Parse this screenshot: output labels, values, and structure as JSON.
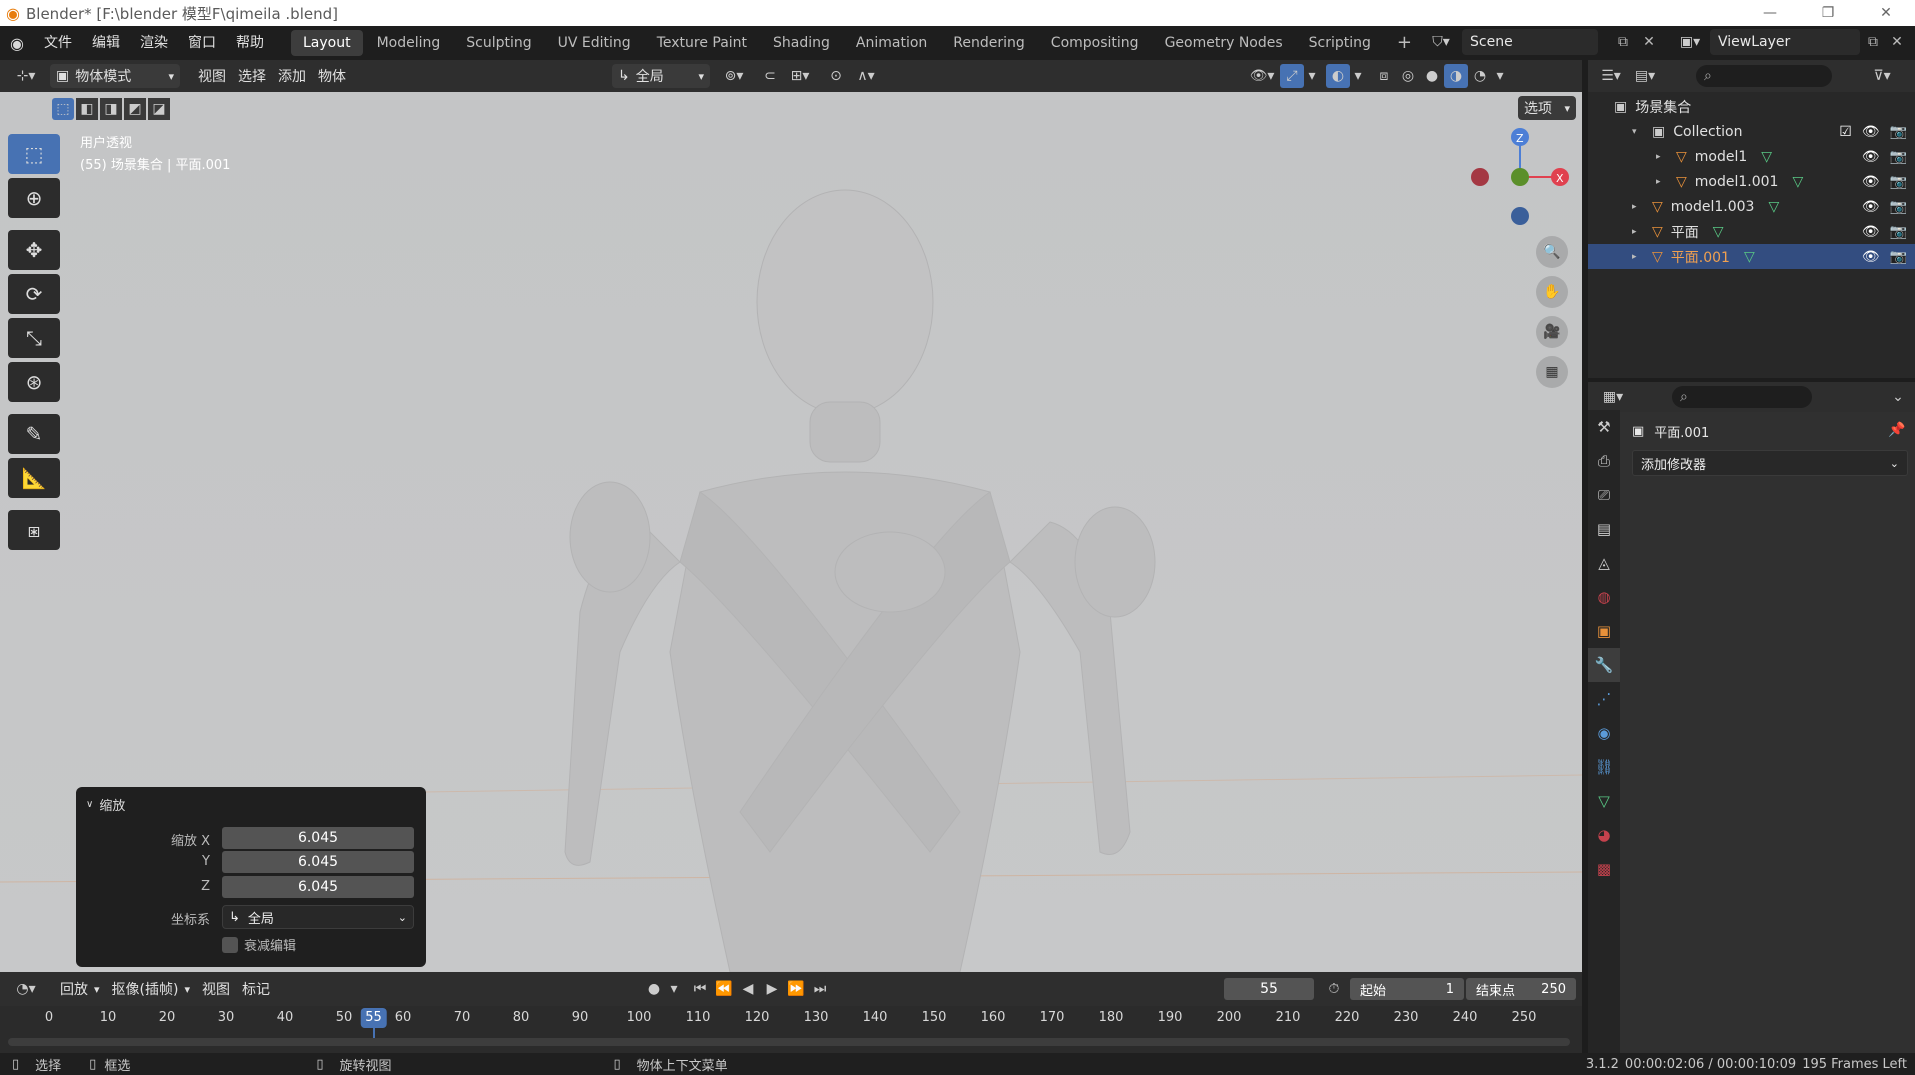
{
  "window": {
    "title": "Blender* [F:\\blender 模型F\\qimeila .blend]",
    "minimize": "—",
    "maximize": "❐",
    "close": "✕"
  },
  "menu": [
    "文件",
    "编辑",
    "渲染",
    "窗口",
    "帮助"
  ],
  "workspaces": [
    "Layout",
    "Modeling",
    "Sculpting",
    "UV Editing",
    "Texture Paint",
    "Shading",
    "Animation",
    "Rendering",
    "Compositing",
    "Geometry Nodes",
    "Scripting"
  ],
  "active_workspace": "Layout",
  "scene": "Scene",
  "view_layer": "ViewLayer",
  "viewport_header": {
    "mode": "物体模式",
    "menus": [
      "视图",
      "选择",
      "添加",
      "物体"
    ],
    "orientation": "全局",
    "options": "选项"
  },
  "viewport": {
    "view_name": "用户透视",
    "object_info": "(55) 场景集合 | 平面.001",
    "axis_z": "Z",
    "axis_x": "X"
  },
  "operator_panel": {
    "title": "缩放",
    "label_x": "缩放 X",
    "label_y": "Y",
    "label_z": "Z",
    "value_x": "6.045",
    "value_y": "6.045",
    "value_z": "6.045",
    "coord_label": "坐标系",
    "coord_value": "全局",
    "proportional": "衰减编辑"
  },
  "timeline": {
    "playback": "回放",
    "keying": "抠像(插帧)",
    "view": "视图",
    "marker": "标记",
    "current_frame": "55",
    "start_label": "起始",
    "start": "1",
    "end_label": "结束点",
    "end": "250",
    "ticks": [
      "0",
      "10",
      "20",
      "30",
      "40",
      "50",
      "60",
      "70",
      "80",
      "90",
      "100",
      "110",
      "120",
      "130",
      "140",
      "150",
      "160",
      "170",
      "180",
      "190",
      "200",
      "210",
      "220",
      "230",
      "240",
      "250"
    ],
    "current_marker": "55"
  },
  "outliner": {
    "root": "场景集合",
    "items": [
      {
        "label": "Collection",
        "indent": 1
      },
      {
        "label": "model1",
        "indent": 2
      },
      {
        "label": "model1.001",
        "indent": 2
      },
      {
        "label": "model1.003",
        "indent": 1
      },
      {
        "label": "平面",
        "indent": 1
      },
      {
        "label": "平面.001",
        "indent": 1,
        "selected": true
      }
    ]
  },
  "properties": {
    "object_name": "平面.001",
    "add_modifier": "添加修改器"
  },
  "status": {
    "select": "选择",
    "box_select": "框选",
    "rotate_view": "旋转视图",
    "context_menu": "物体上下文菜单",
    "version_info": "3.1.2",
    "time_info": "00:00:02:06 / 00:00:10:09",
    "frames_left": "195 Frames Left"
  },
  "colors": {
    "accent": "#4772b3",
    "selected_row": "#334d80",
    "object_orange": "#e8913a",
    "mesh_green": "#59c985"
  }
}
